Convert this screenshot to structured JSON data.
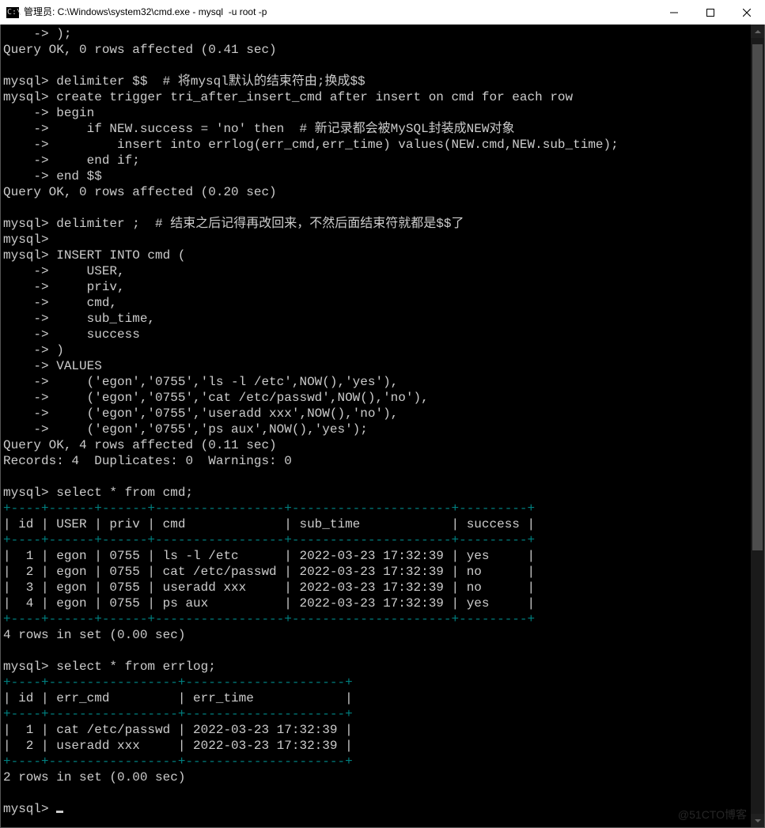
{
  "window": {
    "title": "管理员: C:\\Windows\\system32\\cmd.exe - mysql  -u root -p"
  },
  "session": {
    "l01": "    -> );",
    "l02": "Query OK, 0 rows affected (0.41 sec)",
    "l03": "",
    "l04": "mysql> delimiter $$  # 将mysql默认的结束符由;换成$$",
    "l05": "mysql> create trigger tri_after_insert_cmd after insert on cmd for each row",
    "l06": "    -> begin",
    "l07": "    ->     if NEW.success = 'no' then  # 新记录都会被MySQL封装成NEW对象",
    "l08": "    ->         insert into errlog(err_cmd,err_time) values(NEW.cmd,NEW.sub_time);",
    "l09": "    ->     end if;",
    "l10": "    -> end $$",
    "l11": "Query OK, 0 rows affected (0.20 sec)",
    "l12": "",
    "l13": "mysql> delimiter ;  # 结束之后记得再改回来，不然后面结束符就都是$$了",
    "l14": "mysql>",
    "l15": "mysql> INSERT INTO cmd (",
    "l16": "    ->     USER,",
    "l17": "    ->     priv,",
    "l18": "    ->     cmd,",
    "l19": "    ->     sub_time,",
    "l20": "    ->     success",
    "l21": "    -> )",
    "l22": "    -> VALUES",
    "l23": "    ->     ('egon','0755','ls -l /etc',NOW(),'yes'),",
    "l24": "    ->     ('egon','0755','cat /etc/passwd',NOW(),'no'),",
    "l25": "    ->     ('egon','0755','useradd xxx',NOW(),'no'),",
    "l26": "    ->     ('egon','0755','ps aux',NOW(),'yes');",
    "l27": "Query OK, 4 rows affected (0.11 sec)",
    "l28": "Records: 4  Duplicates: 0  Warnings: 0",
    "l29": "",
    "l30": "mysql> select * from cmd;",
    "t1sep": "+----+------+------+-----------------+---------------------+---------+",
    "t1hdr": "| id | USER | priv | cmd             | sub_time            | success |",
    "t1r1": "|  1 | egon | 0755 | ls -l /etc      | 2022-03-23 17:32:39 | yes     |",
    "t1r2": "|  2 | egon | 0755 | cat /etc/passwd | 2022-03-23 17:32:39 | no      |",
    "t1r3": "|  3 | egon | 0755 | useradd xxx     | 2022-03-23 17:32:39 | no      |",
    "t1r4": "|  4 | egon | 0755 | ps aux          | 2022-03-23 17:32:39 | yes     |",
    "l31": "4 rows in set (0.00 sec)",
    "l32": "",
    "l33": "mysql> select * from errlog;",
    "t2sep": "+----+-----------------+---------------------+",
    "t2hdr": "| id | err_cmd         | err_time            |",
    "t2r1": "|  1 | cat /etc/passwd | 2022-03-23 17:32:39 |",
    "t2r2": "|  2 | useradd xxx     | 2022-03-23 17:32:39 |",
    "l34": "2 rows in set (0.00 sec)",
    "l35": "",
    "l36": "mysql> "
  },
  "cmd_table": {
    "columns": [
      "id",
      "USER",
      "priv",
      "cmd",
      "sub_time",
      "success"
    ],
    "rows": [
      {
        "id": 1,
        "USER": "egon",
        "priv": "0755",
        "cmd": "ls -l /etc",
        "sub_time": "2022-03-23 17:32:39",
        "success": "yes"
      },
      {
        "id": 2,
        "USER": "egon",
        "priv": "0755",
        "cmd": "cat /etc/passwd",
        "sub_time": "2022-03-23 17:32:39",
        "success": "no"
      },
      {
        "id": 3,
        "USER": "egon",
        "priv": "0755",
        "cmd": "useradd xxx",
        "sub_time": "2022-03-23 17:32:39",
        "success": "no"
      },
      {
        "id": 4,
        "USER": "egon",
        "priv": "0755",
        "cmd": "ps aux",
        "sub_time": "2022-03-23 17:32:39",
        "success": "yes"
      }
    ],
    "footer": "4 rows in set (0.00 sec)"
  },
  "errlog_table": {
    "columns": [
      "id",
      "err_cmd",
      "err_time"
    ],
    "rows": [
      {
        "id": 1,
        "err_cmd": "cat /etc/passwd",
        "err_time": "2022-03-23 17:32:39"
      },
      {
        "id": 2,
        "err_cmd": "useradd xxx",
        "err_time": "2022-03-23 17:32:39"
      }
    ],
    "footer": "2 rows in set (0.00 sec)"
  },
  "watermark": "@51CTO博客"
}
